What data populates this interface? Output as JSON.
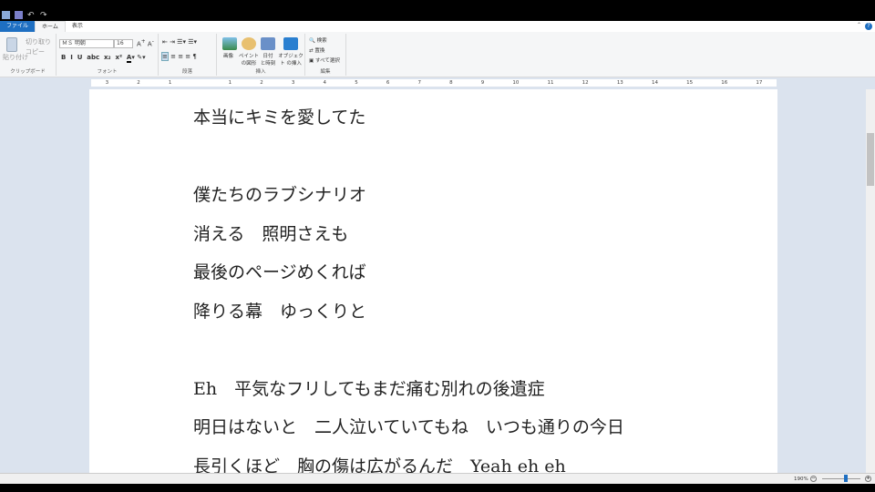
{
  "tabs": {
    "file": "ファイル",
    "home": "ホーム",
    "view": "表示"
  },
  "clipboard": {
    "paste": "貼り付け",
    "cut": "切り取り",
    "copy": "コピー",
    "label": "クリップボード"
  },
  "font": {
    "name": "ＭＳ 明朝",
    "size": "16",
    "label": "フォント"
  },
  "paragraph": {
    "label": "段落"
  },
  "insert": {
    "picture": "画像",
    "paint": "ペイント の図形",
    "datetime": "日付 と時刻",
    "object": "オブジェクト の挿入",
    "label": "挿入"
  },
  "editing": {
    "find": "検索",
    "replace": "置換",
    "select_all": "すべて選択",
    "label": "編集"
  },
  "ruler": [
    "3",
    "2",
    "1",
    "",
    "1",
    "2",
    "3",
    "4",
    "5",
    "6",
    "7",
    "8",
    "9",
    "10",
    "11",
    "12",
    "13",
    "14",
    "15",
    "16",
    "17"
  ],
  "document": {
    "lines": [
      "本当にキミを愛してた",
      "",
      "僕たちのラブシナリオ",
      "消える　照明さえも",
      "最後のページめくれば",
      "降りる幕　ゆっくりと",
      "",
      "Eh　平気なフリしてもまだ痛む別れの後遺症",
      "明日はないと　二人泣いていてもね　いつも通りの今日",
      "長引くほど　胸の傷は広がるんだ　Yeah eh eh"
    ]
  },
  "status": {
    "zoom": "190%"
  }
}
